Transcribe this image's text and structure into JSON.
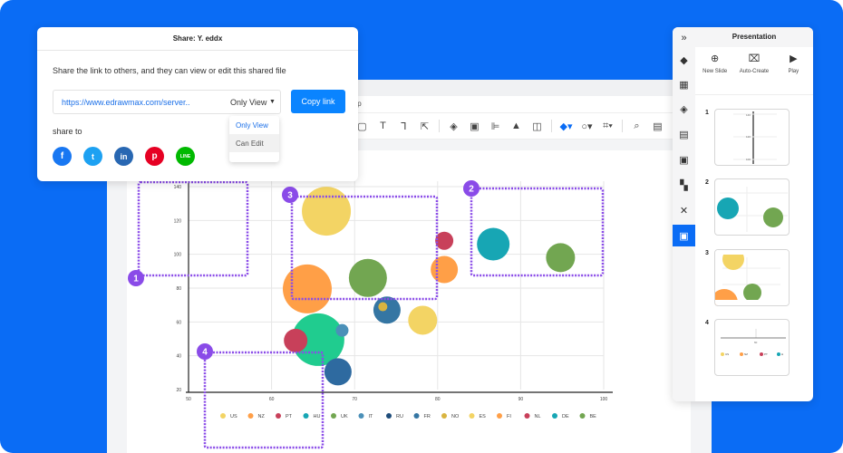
{
  "app": {
    "menubar_fragment": "elp"
  },
  "toolbar": {
    "icons": [
      "rectangle-icon",
      "text-icon",
      "connector-icon",
      "pointer-icon",
      "layers-icon",
      "group-icon",
      "align-icon",
      "flip-icon",
      "frame-icon",
      "fill-color-icon",
      "shape-style-icon",
      "crop-icon",
      "search-icon",
      "preview-icon",
      "pen-icon"
    ]
  },
  "share_dialog": {
    "title": "Share: Y. eddx",
    "description": "Share the link to others, and they can view or edit this shared file",
    "url": "https://www.edrawmax.com/server..",
    "permission": "Only View",
    "copy_label": "Copy link",
    "options": [
      "Only View",
      "Can Edit"
    ],
    "share_to_label": "share to",
    "socials": [
      {
        "name": "facebook",
        "glyph": "f",
        "color": "#1877f2"
      },
      {
        "name": "twitter",
        "glyph": "t",
        "color": "#1da1f2"
      },
      {
        "name": "linkedin",
        "glyph": "in",
        "color": "#2867b2"
      },
      {
        "name": "pinterest",
        "glyph": "p",
        "color": "#e60023"
      },
      {
        "name": "line",
        "glyph": "LINE",
        "color": "#00b900"
      }
    ]
  },
  "presentation": {
    "title": "Presentation",
    "actions": [
      {
        "label": "New Slide",
        "icon": "⊕"
      },
      {
        "label": "Auto-Create",
        "icon": "⌧"
      },
      {
        "label": "Play",
        "icon": "▶"
      }
    ],
    "slides": [
      "1",
      "2",
      "3",
      "4"
    ],
    "slide1_ticks": [
      "140",
      "120",
      "100"
    ],
    "slide4_tick": "60",
    "slide4_legend": [
      "US",
      "NZ",
      "PT",
      "H"
    ]
  },
  "callouts": [
    "1",
    "2",
    "3",
    "4"
  ],
  "chart_data": {
    "type": "scatter",
    "subtype": "bubble",
    "xlabel": "",
    "ylabel": "",
    "xlim": [
      50,
      100
    ],
    "ylim": [
      20,
      140
    ],
    "x_ticks": [
      50,
      60,
      70,
      80,
      90,
      100
    ],
    "y_ticks": [
      20,
      40,
      60,
      80,
      100,
      120,
      140
    ],
    "x_tick_labels": [
      "50",
      "60",
      "70",
      "80",
      "90",
      "100"
    ],
    "y_tick_labels": [
      "20",
      "40",
      "60",
      "80",
      "100",
      "120",
      "140"
    ],
    "grid": true,
    "legend_position": "bottom",
    "series": [
      {
        "name": "US",
        "color": "#f3d464",
        "x": 66.6,
        "y": 125.5,
        "size": 27
      },
      {
        "name": "NZ",
        "color": "#ff9f47",
        "x": 64.3,
        "y": 79.5,
        "size": 27
      },
      {
        "name": "PT",
        "color": "#c8405a",
        "x": 62.9,
        "y": 49,
        "size": 13
      },
      {
        "name": "HU",
        "color": "#20cc8f",
        "x": 65.6,
        "y": 49.5,
        "size": 29
      },
      {
        "name": "UK",
        "color": "#72a651",
        "x": 71.6,
        "y": 86,
        "size": 21
      },
      {
        "name": "IT",
        "color": "#4b90b8",
        "x": 68.5,
        "y": 55,
        "size": 7
      },
      {
        "name": "RU",
        "color": "#2e6aa0",
        "x": 68,
        "y": 30.5,
        "size": 15
      },
      {
        "name": "FR",
        "color": "#3576a3",
        "x": 73.9,
        "y": 67,
        "size": 15
      },
      {
        "name": "NO",
        "color": "#d9b440",
        "x": 73.4,
        "y": 69,
        "size": 5
      },
      {
        "name": "ES",
        "color": "#f3d464",
        "x": 78.2,
        "y": 61,
        "size": 16
      },
      {
        "name": "FI",
        "color": "#ff9f47",
        "x": 80.8,
        "y": 91,
        "size": 15
      },
      {
        "name": "NL",
        "color": "#c8405a",
        "x": 80.8,
        "y": 108,
        "size": 10
      },
      {
        "name": "DE",
        "color": "#17a6b4",
        "x": 86.7,
        "y": 106,
        "size": 18
      },
      {
        "name": "BE",
        "color": "#72a651",
        "x": 94.8,
        "y": 98,
        "size": 16
      }
    ],
    "legend": [
      {
        "name": "US",
        "color": "#f3d464"
      },
      {
        "name": "NZ",
        "color": "#ff9f47"
      },
      {
        "name": "PT",
        "color": "#c8405a"
      },
      {
        "name": "HU",
        "color": "#17a6b4"
      },
      {
        "name": "UK",
        "color": "#72a651"
      },
      {
        "name": "IT",
        "color": "#4b90b8"
      },
      {
        "name": "RU",
        "color": "#1e4c7a"
      },
      {
        "name": "FR",
        "color": "#3576a3"
      },
      {
        "name": "NO",
        "color": "#d9b440"
      },
      {
        "name": "ES",
        "color": "#f3d464"
      },
      {
        "name": "FI",
        "color": "#ff9f47"
      },
      {
        "name": "NL",
        "color": "#c8405a"
      },
      {
        "name": "DE",
        "color": "#17a6b4"
      },
      {
        "name": "BE",
        "color": "#72a651"
      }
    ]
  }
}
